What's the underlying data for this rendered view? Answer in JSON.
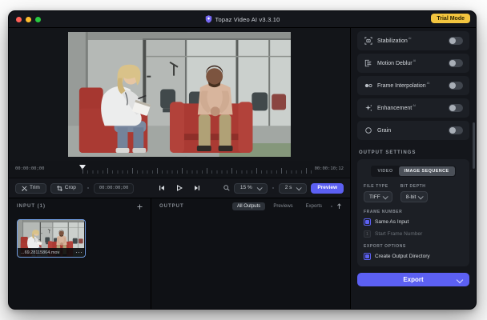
{
  "window": {
    "title": "Topaz Video AI  v3.3.10",
    "trial_badge": "Trial Mode"
  },
  "colors": {
    "accent": "#5c60f3",
    "trial_badge_bg": "#f3c53f",
    "thumbnail_border": "#6f9be0",
    "window_bg": "#0e1014",
    "card_bg": "#1c1f25"
  },
  "icons": {
    "app-logo-icon": "purple shield",
    "stabilization-icon": "camera in brackets",
    "motion-deblur-icon": "square with motion lines",
    "frame-interpolation-icon": "filled and outlined circles",
    "enhancement-icon": "sparkle",
    "grain-icon": "circle outline",
    "trim-icon": "scissors",
    "crop-icon": "crop corners",
    "zoom-icon": "magnifier",
    "prev-frame-icon": "bar with left triangle",
    "play-icon": "outline triangle",
    "next-frame-icon": "bar with right triangle",
    "add-icon": "plus",
    "sort-icon": "arrow up",
    "more-icon": "three dots",
    "chevron-down-icon": "small chevron"
  },
  "preview": {
    "timeline": {
      "start": "00:00:00;00",
      "end": "00:00:10;12"
    },
    "toolbar": {
      "trim": "Trim",
      "crop": "Crop",
      "timecode": "00:00:00;00",
      "zoom_value": "15 %",
      "duration": "2 s",
      "preview_button": "Preview"
    }
  },
  "panels": {
    "input": {
      "title": "INPUT (1)",
      "clip_name": "...69.28115864.mov"
    },
    "output": {
      "title": "OUTPUT",
      "tabs": [
        {
          "label": "All Outputs",
          "active": true
        },
        {
          "label": "Previews",
          "active": false
        },
        {
          "label": "Exports",
          "active": false
        }
      ]
    }
  },
  "sidebar": {
    "filters": [
      {
        "label": "Stabilization",
        "ai": "AI",
        "enabled": false
      },
      {
        "label": "Motion Deblur",
        "ai": "AI",
        "enabled": false
      },
      {
        "label": "Frame Interpolation",
        "ai": "AI",
        "enabled": false
      },
      {
        "label": "Enhancement",
        "ai": "AI",
        "enabled": false
      },
      {
        "label": "Grain",
        "ai": "",
        "enabled": false
      }
    ],
    "output_settings": {
      "heading": "OUTPUT SETTINGS",
      "tabs": [
        {
          "label": "VIDEO",
          "active": false
        },
        {
          "label": "IMAGE SEQUENCE",
          "active": true
        }
      ],
      "file_type_label": "FILE TYPE",
      "file_type_value": "TIFF",
      "bit_depth_label": "BIT DEPTH",
      "bit_depth_value": "8-bit",
      "frame_number_label": "FRAME NUMBER",
      "same_as_input_label": "Same As Input",
      "start_frame_value": "1",
      "start_frame_label": "Start Frame Number",
      "export_options_label": "EXPORT OPTIONS",
      "create_output_dir_label": "Create Output Directory"
    },
    "export_button": "Export"
  }
}
